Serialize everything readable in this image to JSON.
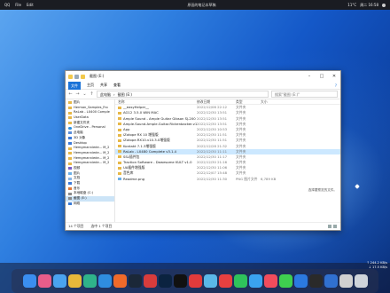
{
  "menubar": {
    "left": [
      "QQ",
      "File",
      "Edit"
    ],
    "center_title": "原画的笔记本草稿",
    "right_items": [
      "11°C",
      "周二 16:58"
    ]
  },
  "window": {
    "title": "截图 (E:)",
    "tabs": [
      "文件",
      "主页",
      "共享",
      "查看"
    ],
    "help": "?",
    "breadcrumb": [
      "此电脑",
      "截图 (E:)"
    ],
    "search_placeholder": "搜索\"截图 (E:)\"",
    "status_count": "14 个项目",
    "status_selected": "选中 1 个项目",
    "preview_text": "选择要预览的文件。"
  },
  "sidebar": [
    {
      "label": "图片",
      "icon": "folder",
      "sel": false
    },
    {
      "label": "Herman_Samples_Fro",
      "icon": "folder",
      "sel": false
    },
    {
      "label": "RaLab - LX400 Comple",
      "icon": "folder",
      "sel": false
    },
    {
      "label": "UserData",
      "icon": "folder",
      "sel": false
    },
    {
      "label": "新建文件夹",
      "icon": "folder",
      "sel": false
    },
    {
      "label": "OneDrive - Personal",
      "icon": "cloud",
      "sel": false
    },
    {
      "label": "此电脑",
      "icon": "pc",
      "sel": false
    },
    {
      "label": "3D 对象",
      "icon": "blue",
      "sel": false
    },
    {
      "label": "Desktop",
      "icon": "blue",
      "sel": false
    },
    {
      "label": "Hemgmanniede... M_2",
      "icon": "folder",
      "sel": false
    },
    {
      "label": "Hemgmanniede... M_2",
      "icon": "folder",
      "sel": false
    },
    {
      "label": "Hemgmanniede... M_2",
      "icon": "folder",
      "sel": false
    },
    {
      "label": "Hemgmanniede... M_2",
      "icon": "folder",
      "sel": false
    },
    {
      "label": "视频",
      "icon": "vid",
      "sel": false
    },
    {
      "label": "图片",
      "icon": "img",
      "sel": false
    },
    {
      "label": "文档",
      "icon": "doc",
      "sel": false
    },
    {
      "label": "下载",
      "icon": "blue",
      "sel": false
    },
    {
      "label": "音乐",
      "icon": "mus",
      "sel": false
    },
    {
      "label": "本地磁盘 (C:)",
      "icon": "drive",
      "sel": false
    },
    {
      "label": "截图 (E:)",
      "icon": "drive",
      "sel": true
    },
    {
      "label": "网络",
      "icon": "net",
      "sel": false
    }
  ],
  "columns": [
    "名称",
    "修改日期",
    "类型",
    "大小"
  ],
  "files": [
    {
      "name": "__easyHelper__",
      "date": "2022/12/06 22:12",
      "type": "文件夹",
      "size": "",
      "sel": false,
      "icon": "folder"
    },
    {
      "name": "AG12 3.5.0 WIN MAC",
      "date": "2022/12/30 13:51",
      "type": "文件夹",
      "size": "",
      "sel": false,
      "icon": "folder"
    },
    {
      "name": "Ample Sound - Ample Guitar Gibson SJ-200",
      "date": "2022/12/30 13:51",
      "type": "文件夹",
      "size": "",
      "sel": false,
      "icon": "folder"
    },
    {
      "name": "Ample.Sound.Ample.Guitar.Rickenbacker.v1.0.0.WIN.OSX",
      "date": "2022/12/30 13:51",
      "type": "文件夹",
      "size": "",
      "sel": false,
      "icon": "folder"
    },
    {
      "name": "App",
      "date": "2022/12/30 10:53",
      "type": "文件夹",
      "size": "",
      "sel": false,
      "icon": "folder"
    },
    {
      "name": "iZotope RX 10 增强版",
      "date": "2022/12/30 11:51",
      "type": "文件夹",
      "size": "",
      "sel": false,
      "icon": "folder"
    },
    {
      "name": "iZotope.RX10.v10.3.0增强版",
      "date": "2022/12/30 11:51",
      "type": "文件夹",
      "size": "",
      "sel": false,
      "icon": "folder"
    },
    {
      "name": "Kontakt 7.1.3增强版",
      "date": "2022/12/28 21:32",
      "type": "文件夹",
      "size": "",
      "sel": false,
      "icon": "folder"
    },
    {
      "name": "RaLab - LX480 Complete v3.1.4",
      "date": "2022/12/30 11:11",
      "type": "文件夹",
      "size": "",
      "sel": true,
      "icon": "folder"
    },
    {
      "name": "SSL插件包",
      "date": "2022/12/30 11:17",
      "type": "文件夹",
      "size": "",
      "sel": false,
      "icon": "folder"
    },
    {
      "name": "Traction Software - Dawesome KULT v1.0",
      "date": "2022/12/30 21:16",
      "type": "文件夹",
      "size": "",
      "sel": false,
      "icon": "folder"
    },
    {
      "name": "UA插件增强版",
      "date": "2022/12/30 11:06",
      "type": "文件夹",
      "size": "",
      "sel": false,
      "icon": "folder"
    },
    {
      "name": "音色库",
      "date": "2022/12/07 15:48",
      "type": "文件夹",
      "size": "",
      "sel": false,
      "icon": "folder"
    },
    {
      "name": "Readme.png",
      "date": "2022/12/30 11:30",
      "type": "PNG 图片文件",
      "size": "6,789 KB",
      "sel": false,
      "icon": "img"
    }
  ],
  "dock": [
    {
      "name": "finder-icon",
      "color": "#3a8ef0"
    },
    {
      "name": "launchpad-icon",
      "color": "#e85d8a"
    },
    {
      "name": "mail-icon",
      "color": "#4aa3f0"
    },
    {
      "name": "chrome-icon",
      "color": "#e8b83a"
    },
    {
      "name": "edge-icon",
      "color": "#2fb38a"
    },
    {
      "name": "safari-icon",
      "color": "#2f8de0"
    },
    {
      "name": "firefox-icon",
      "color": "#f06a2a"
    },
    {
      "name": "steam-icon",
      "color": "#1b2838"
    },
    {
      "name": "wps-icon",
      "color": "#d83c3c"
    },
    {
      "name": "photoshop-icon",
      "color": "#0b2340"
    },
    {
      "name": "capcut-icon",
      "color": "#111111"
    },
    {
      "name": "netease-music-icon",
      "color": "#e23b3b"
    },
    {
      "name": "bilibili-icon",
      "color": "#5ab8e8"
    },
    {
      "name": "pinduoduo-icon",
      "color": "#e84040"
    },
    {
      "name": "wechat-icon",
      "color": "#2fc25b"
    },
    {
      "name": "qq-icon",
      "color": "#3aa3f0"
    },
    {
      "name": "music-icon",
      "color": "#f14c5c"
    },
    {
      "name": "messages-icon",
      "color": "#3fcf4f"
    },
    {
      "name": "windows-icon",
      "color": "#2b79e0"
    },
    {
      "name": "terminal-icon",
      "color": "#2a2a2a"
    },
    {
      "name": "rdp-icon",
      "color": "#3070d0"
    },
    {
      "name": "pd-icon",
      "color": "#d0d0d0"
    },
    {
      "name": "trash-icon",
      "color": "#cfd4da"
    }
  ],
  "tray": {
    "line1": "↑ 244.2 KB/s",
    "line2": "↓ 17.5 KB/s"
  }
}
